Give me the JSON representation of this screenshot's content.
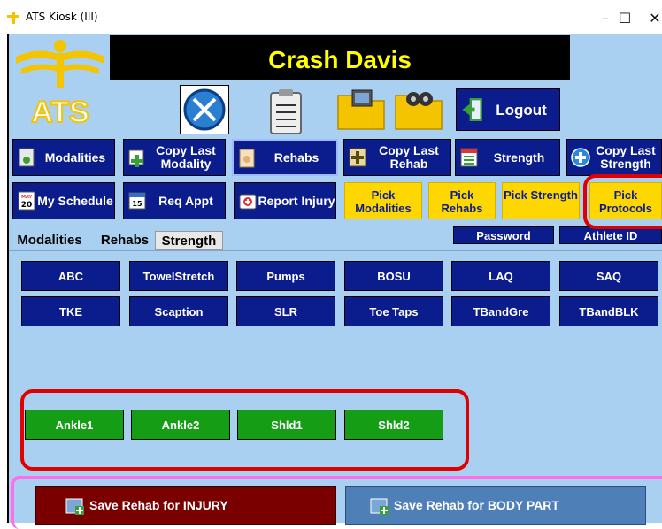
{
  "window": {
    "title": "ATS Kiosk (III)",
    "minimize": "–",
    "maximize": "☐",
    "close": "✕"
  },
  "logo": {
    "text": "ATS"
  },
  "athlete": {
    "name": "Crash  Davis"
  },
  "toolbar_icons": [
    "crossed-tools-icon",
    "clipboard-icon",
    "photo-folder-icon",
    "film-folder-icon"
  ],
  "buttons": {
    "logout": "Logout",
    "modalities": "Modalities",
    "copy_last_modality": "Copy Last Modality",
    "rehabs": "Rehabs",
    "copy_last_rehab": "Copy Last Rehab",
    "strength": "Strength",
    "copy_last_strength": "Copy Last Strength",
    "my_schedule": "My Schedule",
    "req_appt": "Req Appt",
    "report_injury": "Report Injury",
    "pick_modalities": "Pick Modalities",
    "pick_rehabs": "Pick Rehabs",
    "pick_strength": "Pick Strength",
    "pick_protocols": "Pick Protocols",
    "password": "Password",
    "athlete_id": "Athlete ID"
  },
  "calendar_icon": {
    "month": "MAY",
    "day": "20"
  },
  "req_icon": {
    "day": "15"
  },
  "tabs": [
    "Modalities",
    "Rehabs",
    "Strength"
  ],
  "rehab_exercises": [
    "ABC",
    "TowelStretch",
    "Pumps",
    "BOSU",
    "LAQ",
    "SAQ",
    "TKE",
    "Scaption",
    "SLR",
    "Toe Taps",
    "TBandGre",
    "TBandBLK"
  ],
  "protocols": [
    "Ankle1",
    "Ankle2",
    "Shld1",
    "Shld2"
  ],
  "save": {
    "injury": "Save Rehab for INJURY",
    "body_part": "Save Rehab for BODY PART"
  },
  "colors": {
    "client_bg": "#a9d0f0",
    "navy": "#0b1c8c",
    "yellow": "#ffd700",
    "green": "#169d16",
    "maroon": "#7a0000",
    "steel": "#4f7fb7",
    "highlight_red": "#e00000",
    "highlight_pink": "#ff6ee8"
  }
}
